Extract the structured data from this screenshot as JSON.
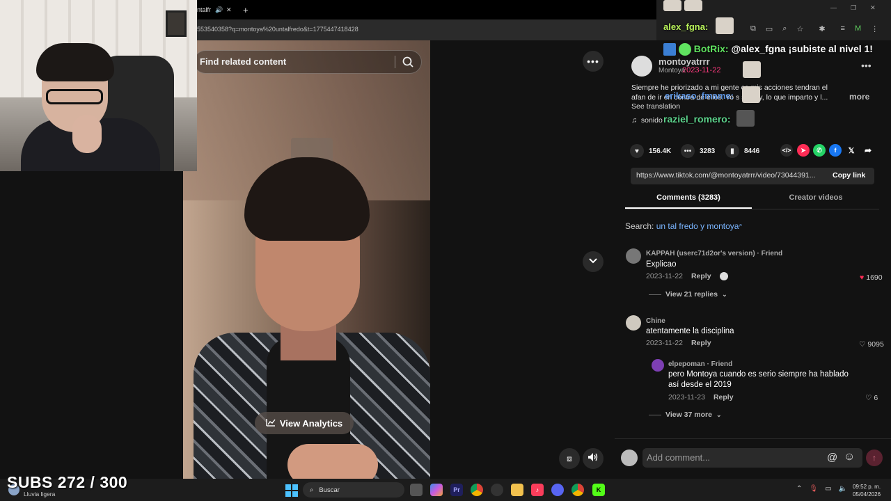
{
  "browser": {
    "tab_title": "ntalfr",
    "address": "553540358?q=montoya%20untalfredo&t=1775447418428"
  },
  "video": {
    "search_placeholder": "Find related content",
    "view_analytics": "View Analytics"
  },
  "post": {
    "author": "montoyatrrr",
    "author_sub": "Montoya",
    "caption": "Siempre he priorizado a mi gente ... ca mis acciones tendran el afan de ir en contra de ellos. Yo ... se soy, lo que imparto y l...",
    "caption_line1": "Siempre he priorizado a mi gente    ca mis acciones tendran el",
    "caption_line2": "afan de ir en contra de ellos. Yo s      se soy, lo que imparto y l...",
    "more": "more",
    "see_translation": "See translation",
    "music": "sonido"
  },
  "stats": {
    "likes": "156.4K",
    "comments": "3283",
    "saves": "8446"
  },
  "link": {
    "url": "https://www.tiktok.com/@montoyatrrr/video/73044391...",
    "copy_label": "Copy link"
  },
  "tabs": {
    "comments": "Comments (3283)",
    "creator": "Creator videos"
  },
  "search_line": {
    "prefix": "Search: ",
    "query": "un tal fredo y montoya"
  },
  "comments": [
    {
      "name": "KAPPAH (userc71d2or's version) · Friend",
      "text": "Explicao",
      "date": "2023-11-22",
      "reply": "Reply",
      "likes": "1690",
      "view_replies": "View 21 replies"
    },
    {
      "name": "Chine",
      "text": "atentamente la disciplina",
      "date": "2023-11-22",
      "reply": "Reply",
      "likes": "9095"
    },
    {
      "name": "elpepoman · Friend",
      "text1": "pero Montoya cuando es serio siempre ha hablado",
      "text2": "así desde el 2019",
      "date": "2023-11-23",
      "reply": "Reply",
      "likes": "6",
      "view_more": "View 37 more"
    }
  ],
  "comment_input": {
    "placeholder": "Add comment..."
  },
  "chat": {
    "alex": "alex_fgna:",
    "bot_name": "BotRix:",
    "bot_msg": "@alex_fgna ¡subiste al nivel 1!",
    "date": "2023-11-22",
    "erik": "erikaso_fmame:",
    "raziel": "raziel_romero:"
  },
  "overlay": {
    "subs": "SUBS 272 / 300"
  },
  "taskbar": {
    "weather": "Lluvia ligera",
    "search": "Buscar",
    "time": "09:52 p. m.",
    "date": "05/04/2026"
  },
  "colors": {
    "accent": "#fe2c55",
    "link": "#7ab5ff",
    "chat_green": "#5fe25f"
  }
}
